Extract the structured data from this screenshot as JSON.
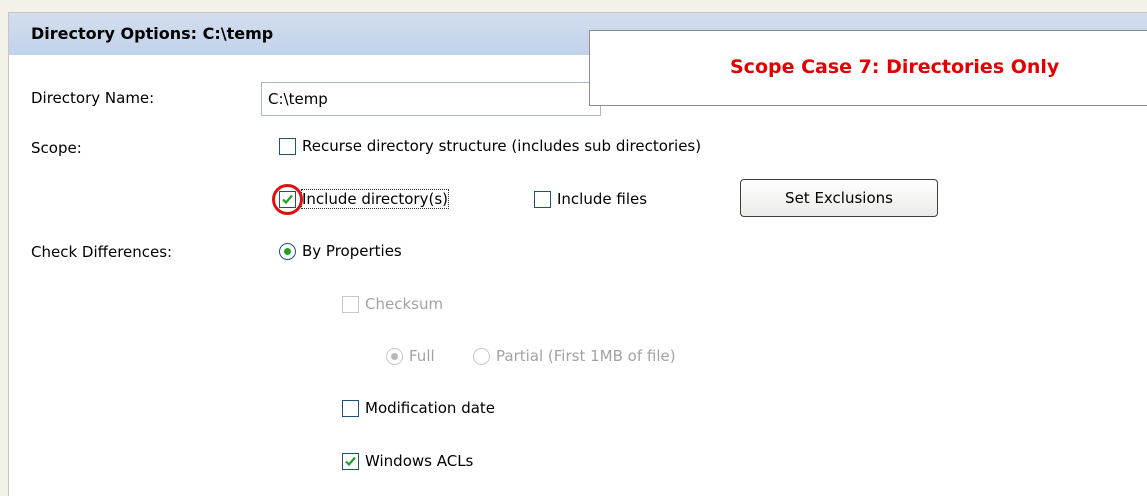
{
  "header": {
    "title": "Directory Options: C:\\temp"
  },
  "callout": {
    "text": "Scope Case 7: Directories Only"
  },
  "form": {
    "directory_name_label": "Directory Name:",
    "directory_name_value": "C:\\temp",
    "scope_label": "Scope:",
    "recurse_label": "Recurse directory structure (includes sub directories)",
    "recurse_checked": false,
    "include_dirs_label": "Include directory(s)",
    "include_dirs_checked": true,
    "include_files_label": "Include files",
    "include_files_checked": false,
    "set_exclusions_label": "Set Exclusions",
    "check_diff_label": "Check Differences:",
    "by_properties_label": "By Properties",
    "by_properties_selected": true,
    "checksum_label": "Checksum",
    "checksum_checked": false,
    "checksum_enabled": false,
    "full_label": "Full",
    "full_selected": true,
    "partial_label": "Partial (First 1MB of file)",
    "partial_selected": false,
    "modification_date_label": "Modification date",
    "modification_date_checked": false,
    "windows_acls_label": "Windows ACLs",
    "windows_acls_checked": true
  },
  "colors": {
    "header_bg": "#c2d2ea",
    "callout_text": "#e30000",
    "check_green": "#21a121",
    "highlight_ring": "#e01010"
  },
  "icons": {
    "check": "checkmark-icon",
    "radio": "radio-dot-icon",
    "highlight": "red-circle-highlight"
  }
}
